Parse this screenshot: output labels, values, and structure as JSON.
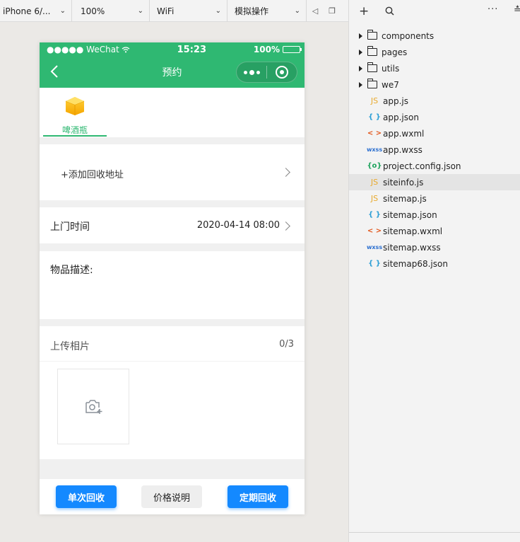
{
  "toolbar": {
    "device": "iPhone 6/...",
    "zoom": "100%",
    "network": "WiFi",
    "simulate": "模拟操作"
  },
  "phone": {
    "status": {
      "carrier": "●●●●● WeChat",
      "time": "15:23",
      "battery": "100%"
    },
    "nav_title": "预约",
    "category": {
      "label": "啤酒瓶"
    },
    "address": "+添加回收地址",
    "time_label": "上门时间",
    "time_value": "2020-04-14 08:00",
    "desc_label": "物品描述:",
    "upload_label": "上传相片",
    "upload_count": "0/3",
    "buttons": {
      "single": "单次回收",
      "price": "价格说明",
      "regular": "定期回收"
    },
    "colors": {
      "theme": "#2fb872",
      "primary_button": "#1489ff"
    }
  },
  "explorer": {
    "items": [
      {
        "type": "folder",
        "name": "components"
      },
      {
        "type": "folder",
        "name": "pages"
      },
      {
        "type": "folder",
        "name": "utils"
      },
      {
        "type": "folder",
        "name": "we7"
      },
      {
        "type": "js",
        "name": "app.js",
        "icon": "JS"
      },
      {
        "type": "json",
        "name": "app.json",
        "icon": "{ }"
      },
      {
        "type": "wxml",
        "name": "app.wxml",
        "icon": "< >"
      },
      {
        "type": "wxss",
        "name": "app.wxss",
        "icon": "wxss"
      },
      {
        "type": "cfg",
        "name": "project.config.json",
        "icon": "{o}"
      },
      {
        "type": "js",
        "name": "siteinfo.js",
        "icon": "JS",
        "selected": true
      },
      {
        "type": "js",
        "name": "sitemap.js",
        "icon": "JS"
      },
      {
        "type": "json",
        "name": "sitemap.json",
        "icon": "{ }"
      },
      {
        "type": "wxml",
        "name": "sitemap.wxml",
        "icon": "< >"
      },
      {
        "type": "wxss",
        "name": "sitemap.wxss",
        "icon": "wxss"
      },
      {
        "type": "json",
        "name": "sitemap68.json",
        "icon": "{ }"
      }
    ]
  }
}
